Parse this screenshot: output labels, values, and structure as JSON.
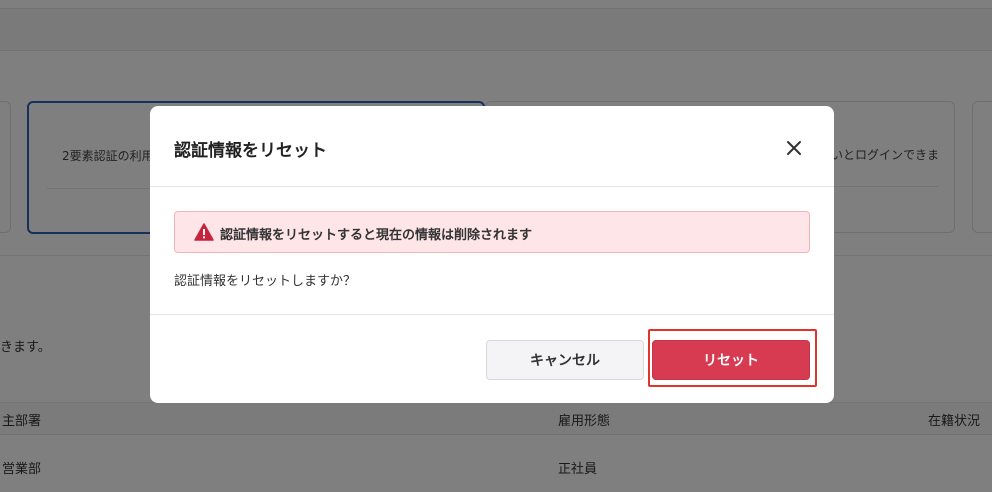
{
  "background": {
    "cards": {
      "selected_text": "2要素認証の利用",
      "mid_text": "いとログインできま"
    },
    "description": "きます。",
    "table": {
      "columns": [
        "主部署",
        "雇用形態",
        "在籍状況"
      ],
      "rows": [
        [
          "営業部",
          "正社員",
          ""
        ]
      ]
    }
  },
  "modal": {
    "title": "認証情報をリセット",
    "close_icon": "close-icon",
    "alert": {
      "icon": "warning-icon",
      "text": "認証情報をリセットすると現在の情報は削除されます",
      "color": "#d63b52"
    },
    "confirm_text": "認証情報をリセットしますか？",
    "buttons": {
      "cancel": "キャンセル",
      "reset": "リセット"
    }
  },
  "colors": {
    "accent": "#d63b52",
    "selected_border": "#2d5fb8",
    "highlight": "#e0352b"
  }
}
